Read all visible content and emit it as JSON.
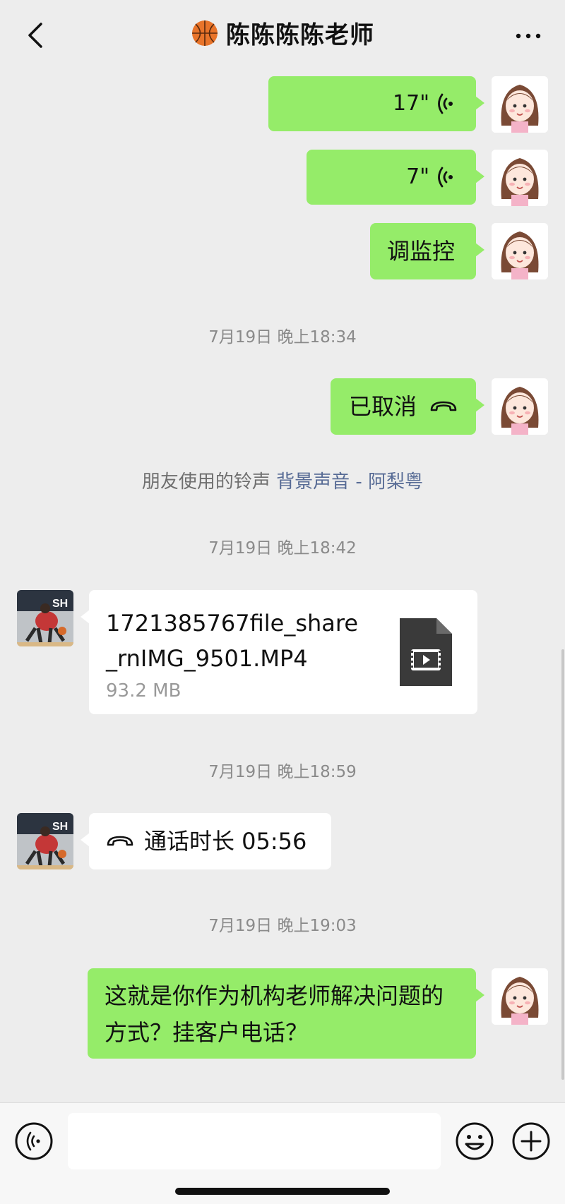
{
  "header": {
    "title": "陈陈陈陈老师",
    "title_emoji": "basketball-icon",
    "back_icon": "chevron-left-icon",
    "more_icon": "more-dots-icon"
  },
  "messages": {
    "voice1": {
      "duration": "17\""
    },
    "voice2": {
      "duration": "7\""
    },
    "text1": "调监控",
    "ts1": "7月19日 晚上18:34",
    "call_cancelled": "已取消",
    "ringtone_prefix": "朋友使用的铃声",
    "ringtone_link": "背景声音 - 阿梨粤",
    "ts2": "7月19日 晚上18:42",
    "file": {
      "name": "1721385767file_share_rnIMG_9501.MP4",
      "size": "93.2 MB"
    },
    "ts3": "7月19日 晚上18:59",
    "call_duration": "通话时长 05:56",
    "ts4": "7月19日 晚上19:03",
    "text2": "这就是你作为机构老师解决问题的方式？挂客户电话？"
  },
  "input": {
    "placeholder": "",
    "voice_icon": "voice-input-icon",
    "emoji_icon": "emoji-icon",
    "plus_icon": "plus-icon"
  },
  "colors": {
    "background": "#ededed",
    "my_bubble": "#95ec69",
    "their_bubble": "#ffffff",
    "link": "#576b95",
    "timestamp": "#8a8a8a"
  }
}
